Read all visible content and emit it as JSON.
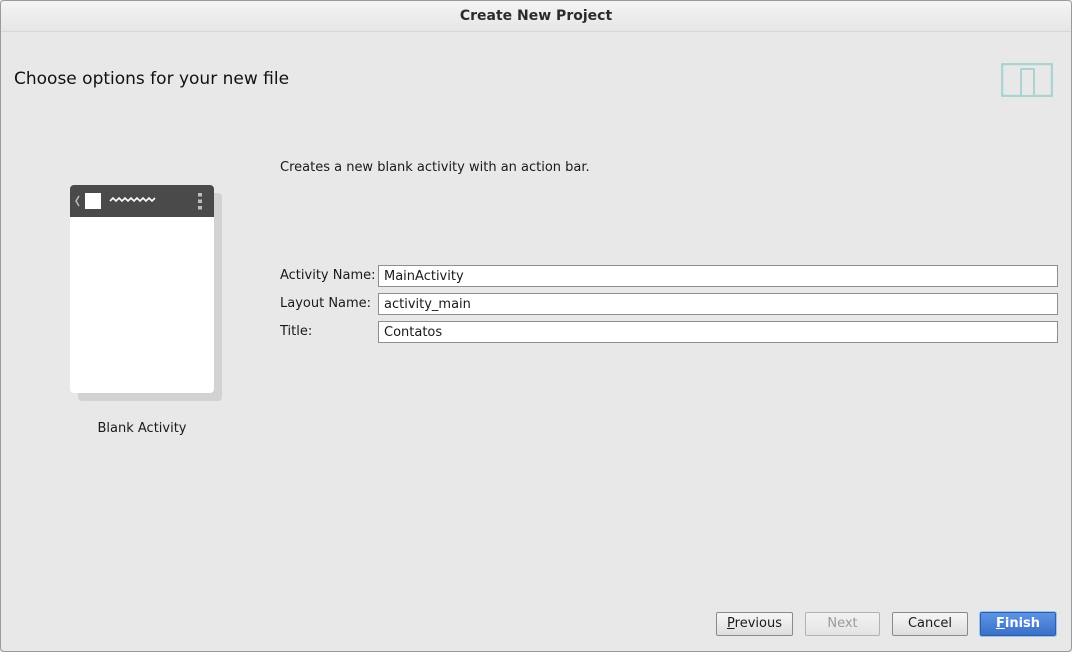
{
  "window": {
    "title": "Create New Project"
  },
  "page": {
    "heading": "Choose options for your new file",
    "header_icon": "device-icon"
  },
  "preview": {
    "caption": "Blank Activity",
    "icons": [
      "back-chevron-icon",
      "app-icon",
      "title-squiggle-icon",
      "overflow-menu-icon"
    ]
  },
  "description": "Creates a new blank activity with an action bar.",
  "form": {
    "activity_name": {
      "label": "Activity Name:",
      "value": "MainActivity"
    },
    "layout_name": {
      "label": "Layout Name:",
      "value": "activity_main"
    },
    "title": {
      "label": "Title:",
      "value": "Contatos"
    }
  },
  "buttons": {
    "previous": {
      "mnemonic": "P",
      "rest": "revious"
    },
    "next": {
      "label": "Next"
    },
    "cancel": {
      "label": "Cancel"
    },
    "finish": {
      "mnemonic": "F",
      "rest": "inish"
    }
  },
  "colors": {
    "accent": "#3a71c9",
    "icon_teal": "#a8d4d4",
    "preview_bar": "#4a4a4a"
  }
}
